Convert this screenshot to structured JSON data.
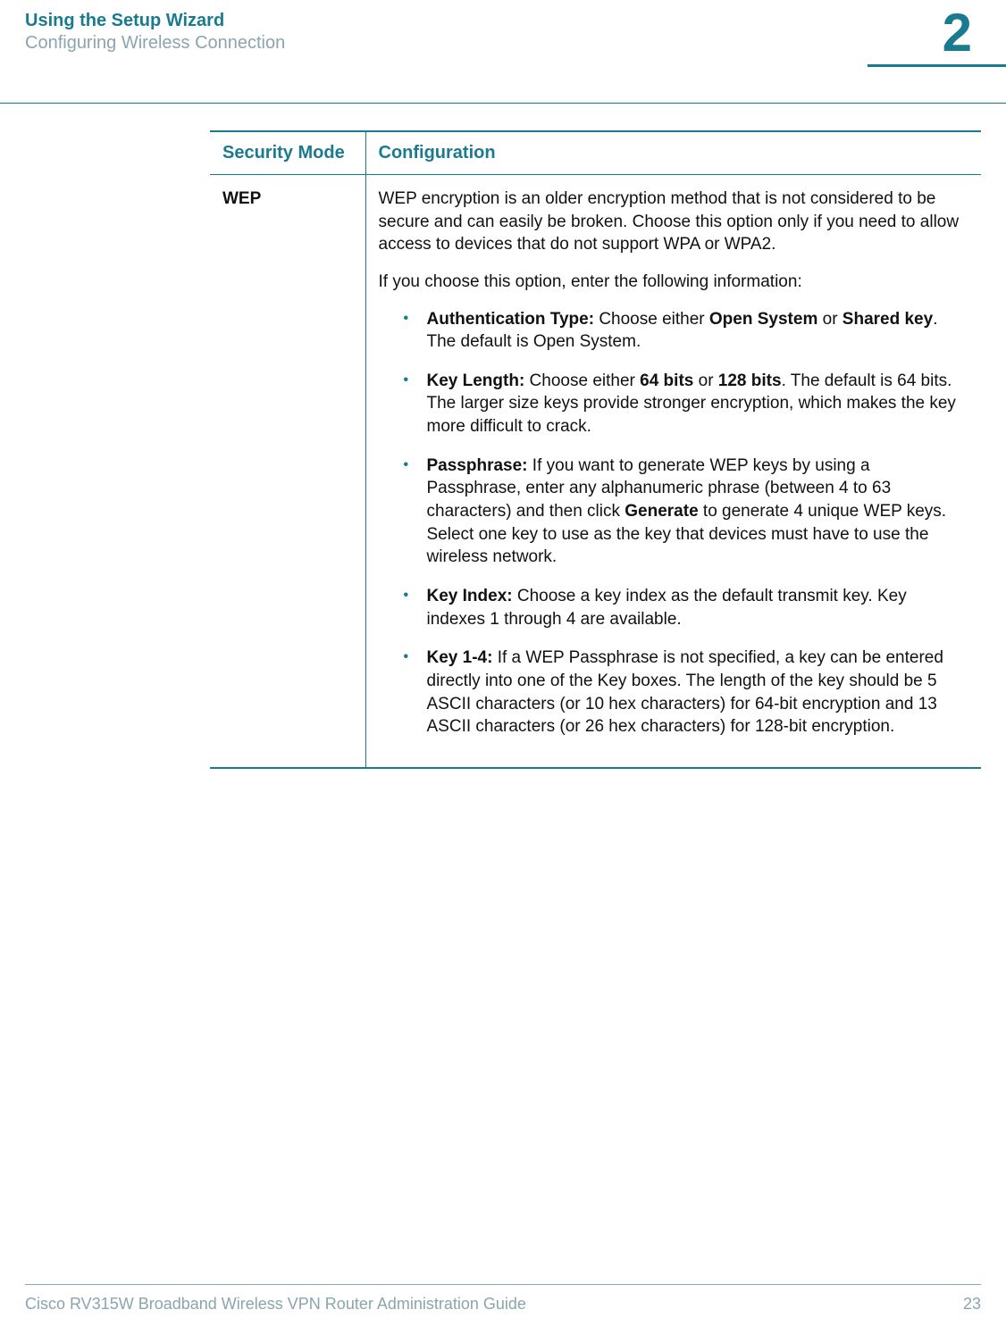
{
  "header": {
    "title": "Using the Setup Wizard",
    "subtitle": "Configuring Wireless Connection",
    "chapter": "2"
  },
  "table": {
    "columns": {
      "mode": "Security Mode",
      "config": "Configuration"
    },
    "row": {
      "mode": "WEP",
      "intro": "WEP encryption is an older encryption method that is not considered to be secure and can easily be broken. Choose this option only if you need to allow access to devices that do not support WPA or WPA2.",
      "subintro": "If you choose this option, enter the following information:",
      "items": {
        "auth": {
          "label": "Authentication Type:",
          "t1": " Choose either ",
          "b1": "Open System",
          "t2": " or ",
          "b2": "Shared key",
          "t3": ". The default is Open System."
        },
        "keylen": {
          "label": "Key Length:",
          "t1": " Choose either ",
          "b1": "64 bits",
          "t2": " or ",
          "b2": "128 bits",
          "t3": ". The default is 64 bits. The larger size keys provide stronger encryption, which makes the key more difficult to crack."
        },
        "pass": {
          "label": "Passphrase:",
          "t1": " If you want to generate WEP keys by using a Passphrase, enter any alphanumeric phrase (between 4 to 63 characters) and then click ",
          "b1": "Generate",
          "t2": " to generate 4 unique WEP keys. Select one key to use as the key that devices must have to use the wireless network."
        },
        "keyidx": {
          "label": "Key Index:",
          "t1": " Choose a key index as the default transmit key. Key indexes 1 through 4 are available."
        },
        "key14": {
          "label": "Key 1-4:",
          "t1": " If a WEP Passphrase is not specified, a key can be entered directly into one of the Key boxes. The length of the key should be 5 ASCII characters (or 10 hex characters) for 64-bit encryption and 13 ASCII characters (or 26 hex characters) for 128-bit encryption."
        }
      }
    }
  },
  "footer": {
    "guide": "Cisco RV315W Broadband Wireless VPN Router Administration Guide",
    "page": "23"
  }
}
